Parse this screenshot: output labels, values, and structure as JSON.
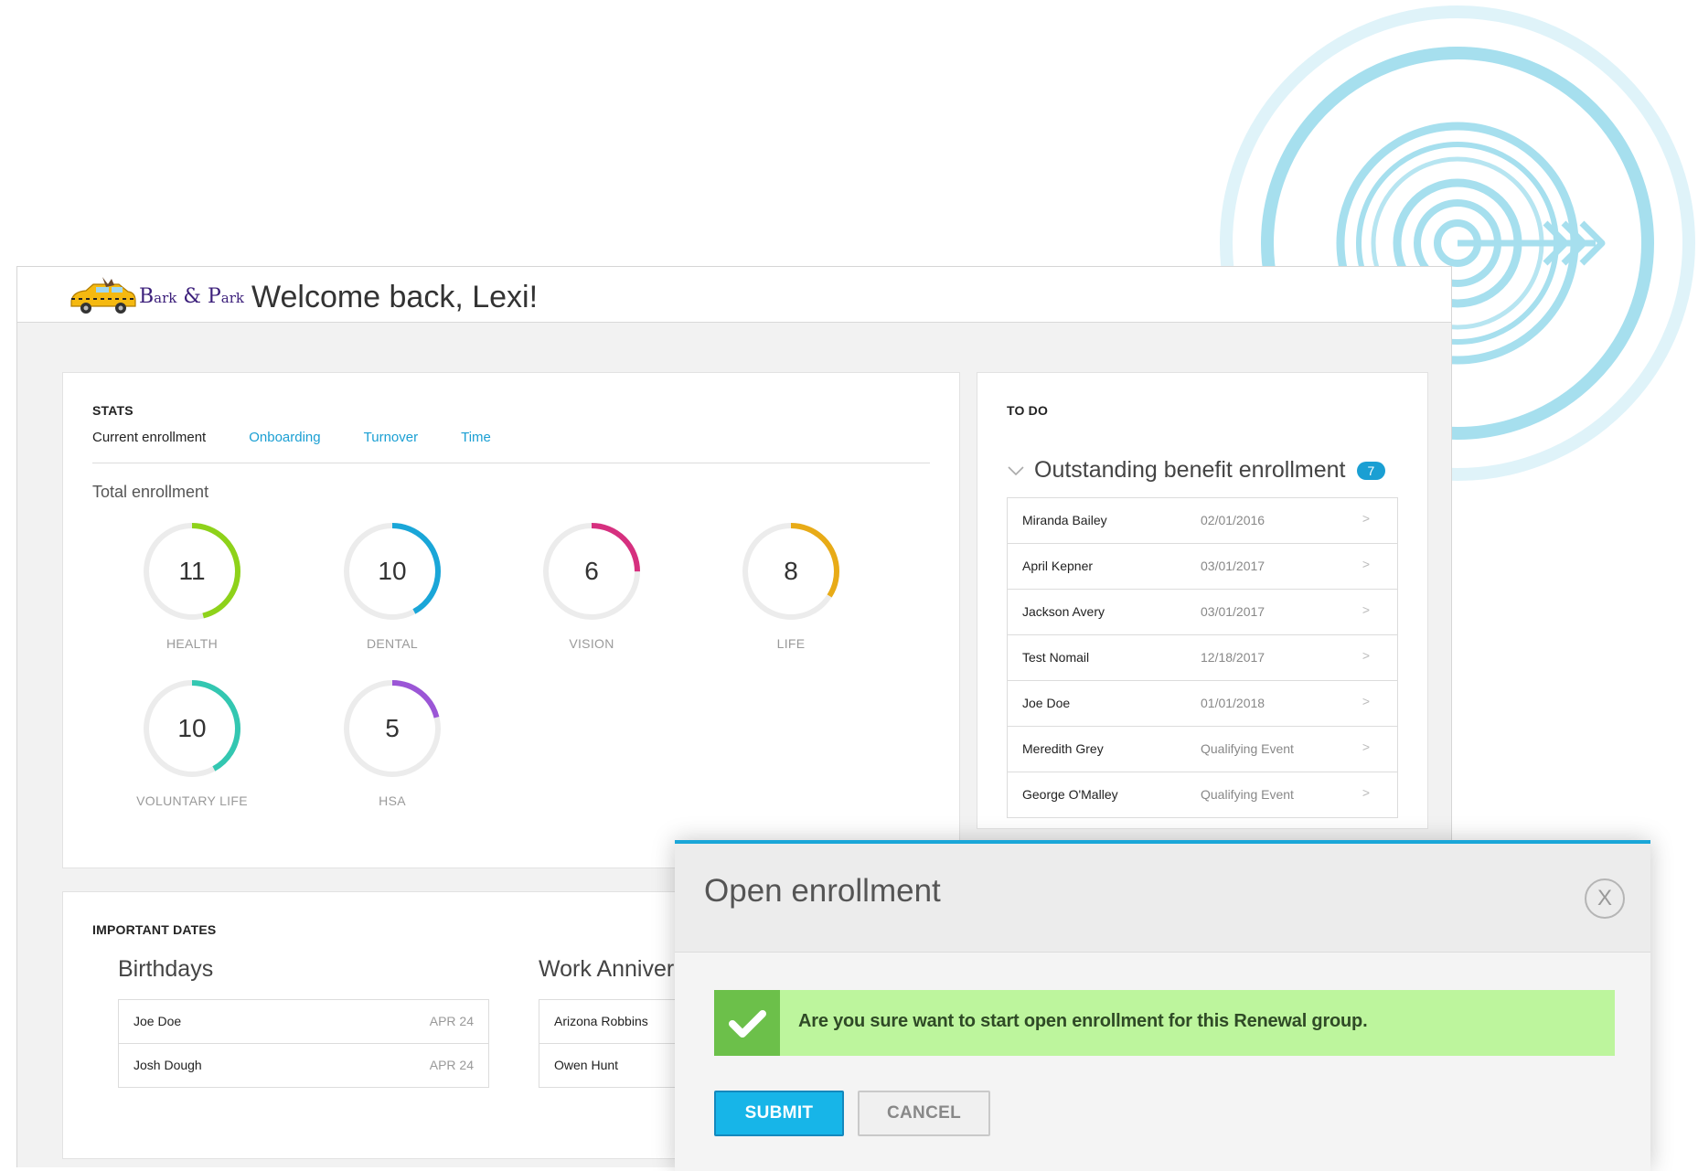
{
  "header": {
    "logo_text_big1": "B",
    "logo_text_small1": "ark",
    "logo_text_amp": " & ",
    "logo_text_big2": "P",
    "logo_text_small2": "ark",
    "welcome": "Welcome back, Lexi!"
  },
  "stats": {
    "title": "STATS",
    "tabs": [
      "Current enrollment",
      "Onboarding",
      "Turnover",
      "Time"
    ],
    "subtitle": "Total enrollment",
    "items": [
      {
        "label": "HEALTH",
        "value": "11",
        "fraction": 0.46,
        "color": "#8ed21a"
      },
      {
        "label": "DENTAL",
        "value": "10",
        "fraction": 0.42,
        "color": "#1aa6d8"
      },
      {
        "label": "VISION",
        "value": "6",
        "fraction": 0.25,
        "color": "#d6307f"
      },
      {
        "label": "LIFE",
        "value": "8",
        "fraction": 0.34,
        "color": "#e8ab17"
      },
      {
        "label": "VOLUNTARY LIFE",
        "value": "10",
        "fraction": 0.42,
        "color": "#33c7b1"
      },
      {
        "label": "HSA",
        "value": "5",
        "fraction": 0.21,
        "color": "#9b56d6"
      }
    ]
  },
  "todo": {
    "title": "TO DO",
    "heading": "Outstanding benefit enrollment",
    "badge": "7",
    "rows": [
      {
        "name": "Miranda  Bailey",
        "date": "02/01/2016"
      },
      {
        "name": "April Kepner",
        "date": "03/01/2017"
      },
      {
        "name": "Jackson Avery",
        "date": "03/01/2017"
      },
      {
        "name": "Test Nomail",
        "date": "12/18/2017"
      },
      {
        "name": "Joe Doe",
        "date": "01/01/2018"
      },
      {
        "name": "Meredith Grey",
        "date": "Qualifying Event"
      },
      {
        "name": "George  O'Malley",
        "date": "Qualifying Event"
      }
    ]
  },
  "important_dates": {
    "title": "IMPORTANT DATES",
    "birthdays": {
      "title": "Birthdays",
      "rows": [
        {
          "name": "Joe Doe",
          "date": "APR 24"
        },
        {
          "name": "Josh Dough",
          "date": "APR 24"
        }
      ]
    },
    "anniversaries": {
      "title": "Work Anniver",
      "rows": [
        {
          "name": "Arizona Robbins"
        },
        {
          "name": "Owen Hunt"
        }
      ]
    }
  },
  "modal": {
    "title": "Open enrollment",
    "close": "X",
    "message": "Are you sure want to start open enrollment for this Renewal group.",
    "submit": "SUBMIT",
    "cancel": "CANCEL"
  },
  "colors": {
    "accent": "#1aa6d8",
    "target": "#a6dfee",
    "success": "#6cc04a",
    "success_bg": "#bdf59d"
  },
  "icons": [
    "target-arrow-icon",
    "taxi-logo-icon",
    "chevron-down-icon",
    "chevron-right-icon",
    "check-icon",
    "close-icon"
  ]
}
